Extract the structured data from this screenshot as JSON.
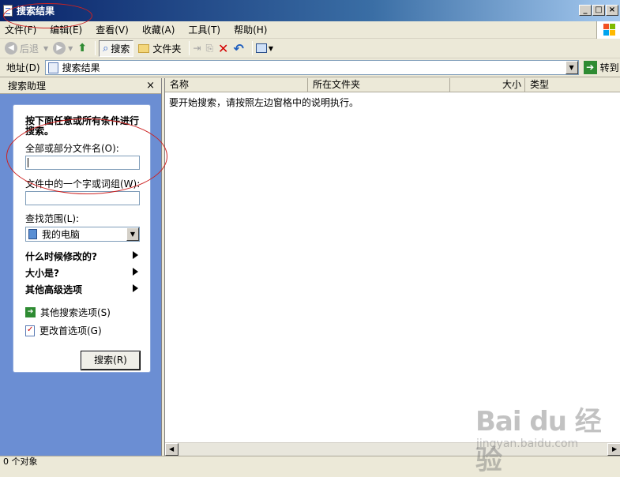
{
  "window": {
    "title": "搜索结果"
  },
  "menu": [
    {
      "label": "文件(F)"
    },
    {
      "label": "编辑(E)"
    },
    {
      "label": "查看(V)"
    },
    {
      "label": "收藏(A)"
    },
    {
      "label": "工具(T)"
    },
    {
      "label": "帮助(H)"
    }
  ],
  "toolbar": {
    "back": "后退",
    "search": "搜索",
    "folders": "文件夹"
  },
  "address": {
    "label": "地址(D)",
    "value": "搜索结果",
    "go": "转到"
  },
  "search_pane": {
    "title": "搜索助理",
    "close": "×",
    "instruction": "按下面任意或所有条件进行搜索。",
    "filename_label": "全部或部分文件名(O):",
    "filename_value": "",
    "phrase_label": "文件中的一个字或词组(W):",
    "phrase_value": "",
    "lookin_label": "查找范围(L):",
    "lookin_value": "我的电脑",
    "when_modified": "什么时候修改的?",
    "size": "大小是?",
    "advanced": "其他高级选项",
    "other_options": "其他搜索选项(S)",
    "change_prefs": "更改首选项(G)",
    "search_button": "搜索(R)"
  },
  "results": {
    "columns": [
      "名称",
      "所在文件夹",
      "大小",
      "类型"
    ],
    "empty_message": "要开始搜索，请按照左边窗格中的说明执行。"
  },
  "status": {
    "text": "0 个对象"
  },
  "watermark": {
    "brand": "Bai du 经验",
    "url": "jingyan.baidu.com"
  }
}
